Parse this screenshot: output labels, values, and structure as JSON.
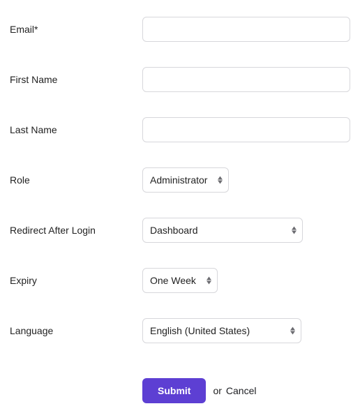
{
  "fields": {
    "email": {
      "label": "Email*",
      "value": ""
    },
    "firstName": {
      "label": "First Name",
      "value": ""
    },
    "lastName": {
      "label": "Last Name",
      "value": ""
    },
    "role": {
      "label": "Role",
      "value": "Administrator"
    },
    "redirect": {
      "label": "Redirect After Login",
      "value": "Dashboard"
    },
    "expiry": {
      "label": "Expiry",
      "value": "One Week"
    },
    "language": {
      "label": "Language",
      "value": "English (United States)"
    }
  },
  "actions": {
    "submit": "Submit",
    "or": "or",
    "cancel": "Cancel"
  }
}
